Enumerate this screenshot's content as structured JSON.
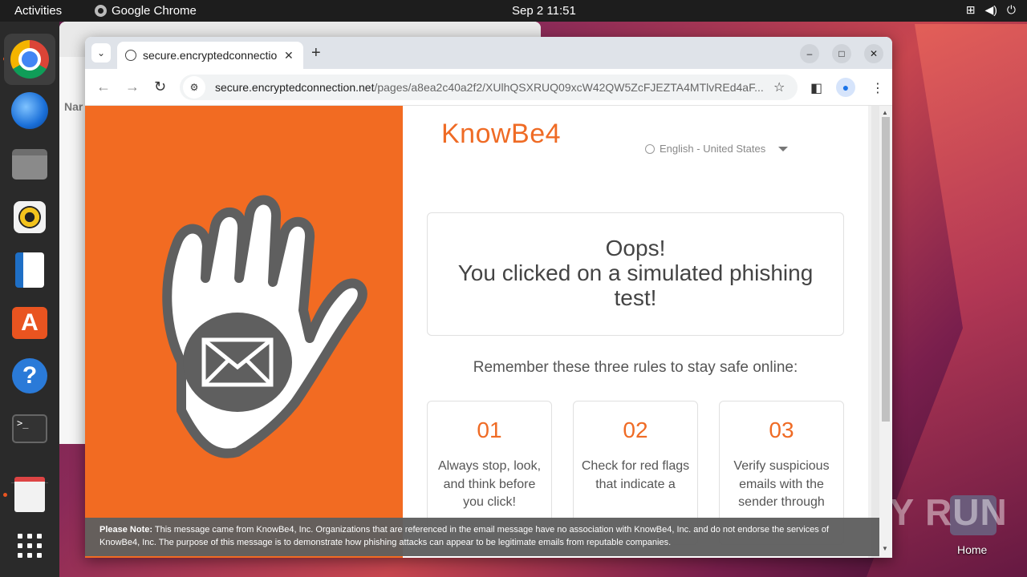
{
  "topbar": {
    "activities": "Activities",
    "app_name": "Google Chrome",
    "datetime": "Sep 2  11:51"
  },
  "dock": {
    "items": [
      {
        "name": "chrome-icon"
      },
      {
        "name": "thunderbird-icon"
      },
      {
        "name": "files-icon"
      },
      {
        "name": "rhythmbox-icon"
      },
      {
        "name": "writer-icon"
      },
      {
        "name": "app-center-icon"
      },
      {
        "name": "help-icon"
      },
      {
        "name": "terminal-icon"
      },
      {
        "name": "document-viewer-icon"
      },
      {
        "name": "show-apps-icon"
      }
    ]
  },
  "background_window": {
    "sidebar_label": "Nar"
  },
  "desktop": {
    "home_label": "Home",
    "watermark": "ANY RUN"
  },
  "browser": {
    "tab_title": "secure.encryptedconnection",
    "url_host": "secure.encryptedconnection.net",
    "url_path": "/pages/a8ea2c40a2f2/XUlhQSXRUQ09xcW42QW5ZcFJEZTA4MTlvREd4aF..."
  },
  "page": {
    "logo": "KnowBe4",
    "language": "English - United States",
    "oops_line1": "Oops!",
    "oops_line2": "You clicked on a simulated phishing test!",
    "rules_title": "Remember these three rules to stay safe online:",
    "rules": [
      {
        "num": "01",
        "text": "Always stop, look, and think before you click!"
      },
      {
        "num": "02",
        "text": "Check for red flags that indicate a"
      },
      {
        "num": "03",
        "text": "Verify suspicious emails with the sender through"
      }
    ],
    "notice_label": "Please Note:",
    "notice_text": "This message came from KnowBe4, Inc. Organizations that are referenced in the email message have no association with KnowBe4, Inc. and do not endorse the services of KnowBe4, Inc. The purpose of this message is to demonstrate how phishing attacks can appear to be legitimate emails from reputable companies."
  },
  "colors": {
    "accent": "#f26b22",
    "topbar": "#1d1d1d",
    "dock": "#2a2a2a"
  }
}
